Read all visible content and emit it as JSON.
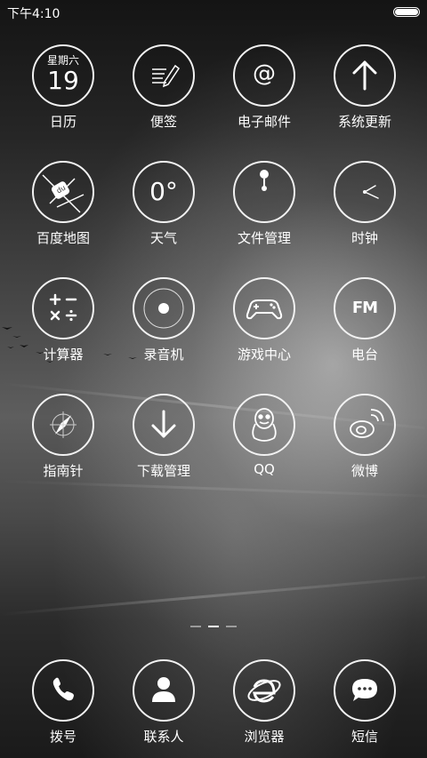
{
  "status_bar": {
    "time": "下午4:10",
    "icons": [
      "battery-icon"
    ]
  },
  "apps": [
    {
      "id": "calendar",
      "label": "日历",
      "icon": "calendar-icon",
      "weekday": "星期六",
      "date": "19"
    },
    {
      "id": "notes",
      "label": "便签",
      "icon": "notes-icon"
    },
    {
      "id": "email",
      "label": "电子邮件",
      "icon": "email-icon",
      "symbol": "@"
    },
    {
      "id": "update",
      "label": "系统更新",
      "icon": "arrow-up-icon"
    },
    {
      "id": "baidu-map",
      "label": "百度地图",
      "icon": "baidu-map-icon"
    },
    {
      "id": "weather",
      "label": "天气",
      "icon": "weather-icon",
      "value": "0°"
    },
    {
      "id": "files",
      "label": "文件管理",
      "icon": "file-manager-icon"
    },
    {
      "id": "clock",
      "label": "时钟",
      "icon": "clock-icon"
    },
    {
      "id": "calculator",
      "label": "计算器",
      "icon": "calculator-icon"
    },
    {
      "id": "recorder",
      "label": "录音机",
      "icon": "recorder-icon"
    },
    {
      "id": "game-center",
      "label": "游戏中心",
      "icon": "gamepad-icon"
    },
    {
      "id": "radio",
      "label": "电台",
      "icon": "radio-icon",
      "text": "FM"
    },
    {
      "id": "compass",
      "label": "指南针",
      "icon": "compass-icon"
    },
    {
      "id": "downloads",
      "label": "下载管理",
      "icon": "download-icon"
    },
    {
      "id": "qq",
      "label": "QQ",
      "icon": "qq-penguin-icon"
    },
    {
      "id": "weibo",
      "label": "微博",
      "icon": "weibo-icon"
    }
  ],
  "page_indicator": {
    "pages": 3,
    "active": 2
  },
  "dock": [
    {
      "id": "dialer",
      "label": "拨号",
      "icon": "phone-icon"
    },
    {
      "id": "contacts",
      "label": "联系人",
      "icon": "contacts-icon"
    },
    {
      "id": "browser",
      "label": "浏览器",
      "icon": "browser-icon"
    },
    {
      "id": "sms",
      "label": "短信",
      "icon": "message-icon"
    }
  ]
}
